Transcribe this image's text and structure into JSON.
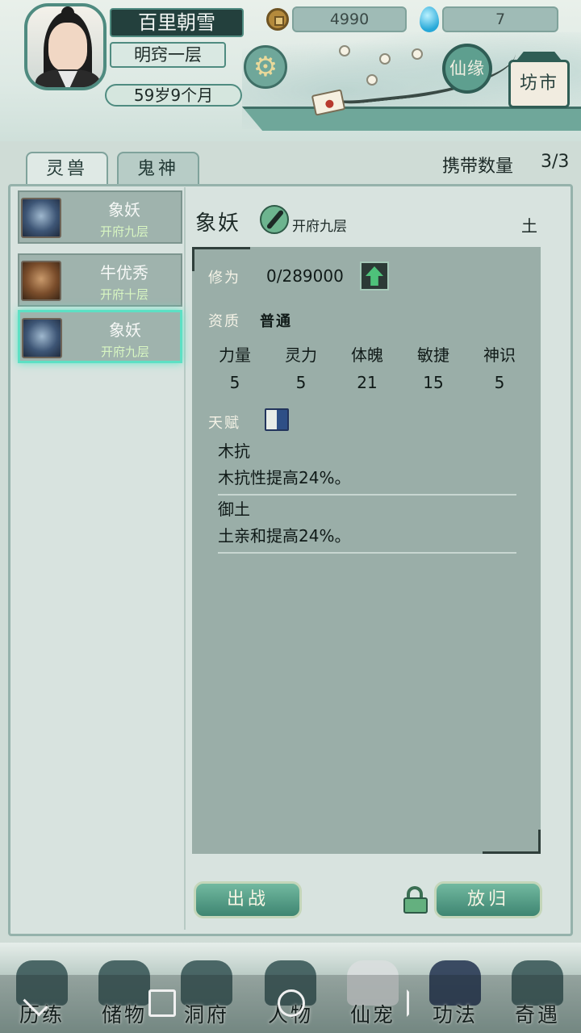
{
  "header": {
    "player_name": "百里朝雪",
    "realm": "明窍一层",
    "age": "59岁9个月",
    "coins": "4990",
    "spirit_stones": "7",
    "xianyuan_label": "仙缘",
    "fangshi_label": "坊市"
  },
  "tabs": [
    {
      "label": "灵兽",
      "active": true
    },
    {
      "label": "鬼神",
      "active": false
    }
  ],
  "carry": {
    "label": "携带数量",
    "value": "3/3"
  },
  "pets": [
    {
      "name": "象妖",
      "level": "开府九层",
      "icon": "elephant-demon-icon",
      "selected": false
    },
    {
      "name": "牛优秀",
      "level": "开府十层",
      "icon": "bull-demon-icon",
      "selected": false
    },
    {
      "name": "象妖",
      "level": "开府九层",
      "icon": "elephant-demon-icon",
      "selected": true
    }
  ],
  "detail": {
    "name": "象妖",
    "level": "开府九层",
    "element": "土",
    "cultivation_label": "修为",
    "cultivation_value": "0/289000",
    "aptitude_label": "资质",
    "aptitude_value": "普通",
    "stats": [
      {
        "label": "力量",
        "value": "5"
      },
      {
        "label": "灵力",
        "value": "5"
      },
      {
        "label": "体魄",
        "value": "21"
      },
      {
        "label": "敏捷",
        "value": "15"
      },
      {
        "label": "神识",
        "value": "5"
      }
    ],
    "talent_label": "天赋",
    "talents": [
      {
        "name": "木抗",
        "desc": "木抗性提高24%。"
      },
      {
        "name": "御土",
        "desc": "土亲和提高24%。"
      }
    ]
  },
  "actions": {
    "deploy": "出战",
    "release": "放归"
  },
  "bottom_nav": [
    "历练",
    "储物",
    "洞府",
    "人物",
    "仙宠",
    "功法",
    "奇遇"
  ],
  "colors": {
    "accent": "#4f8b80",
    "selected_glow": "#5de0c4",
    "button": "#3e8571"
  }
}
